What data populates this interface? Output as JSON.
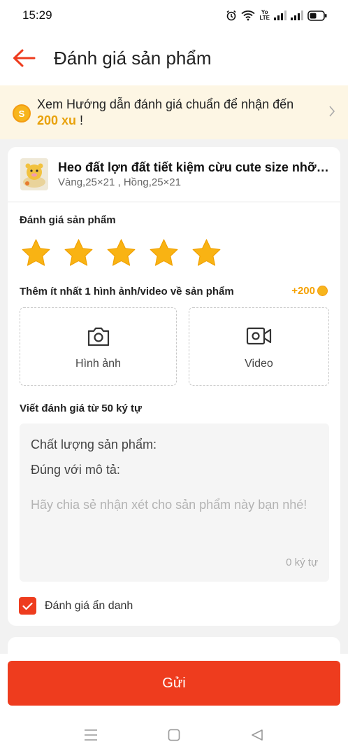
{
  "status_bar": {
    "time": "15:29",
    "icons": [
      "alarm-icon",
      "wifi-icon",
      "volte-icon",
      "signal-icon",
      "signal-icon",
      "battery-icon"
    ],
    "volte_top": "Yo",
    "volte_bottom": "LTE"
  },
  "header": {
    "back_icon": "arrow-left-icon",
    "title": "Đánh giá sản phẩm"
  },
  "promo_banner": {
    "coin_icon": "coin-icon",
    "coin_glyph": "S",
    "text": "Xem Hướng dẫn đánh giá chuẩn để nhận đến",
    "reward": "200 xu",
    "suffix": " !",
    "chevron_icon": "chevron-right-icon"
  },
  "product": {
    "thumbnail": "product-image",
    "name": "Heo đất lợn đất tiết kiệm cừu cute size nhỡ đựng được nhiều",
    "variant": "Vàng,25×21 , Hồng,25×21"
  },
  "rating": {
    "label": "Đánh giá sản phẩm",
    "value": 5,
    "max": 5,
    "star_icon": "star-icon",
    "star_color": "#f9b313"
  },
  "media": {
    "label": "Thêm ít nhất 1 hình ảnh/video về sản phẩm",
    "bonus": "+200",
    "bonus_color": "#f5a100",
    "photo": {
      "label": "Hình ảnh",
      "icon": "camera-icon"
    },
    "video": {
      "label": "Video",
      "icon": "video-camera-icon"
    }
  },
  "review": {
    "label": "Viết đánh giá từ 50 ký tự",
    "prompt_quality": "Chất lượng sản phẩm:",
    "prompt_match": "Đúng với mô tả:",
    "placeholder": "Hãy chia sẻ nhận xét cho sản phẩm này bạn nhé!",
    "char_count": "0 ký tự"
  },
  "anonymous": {
    "label": "Đánh giá ẩn danh",
    "checked": true
  },
  "submit": {
    "label": "Gửi",
    "color": "#ee3c1e"
  },
  "nav_bar": {
    "icons": [
      "menu-icon",
      "home-icon",
      "back-icon"
    ]
  }
}
